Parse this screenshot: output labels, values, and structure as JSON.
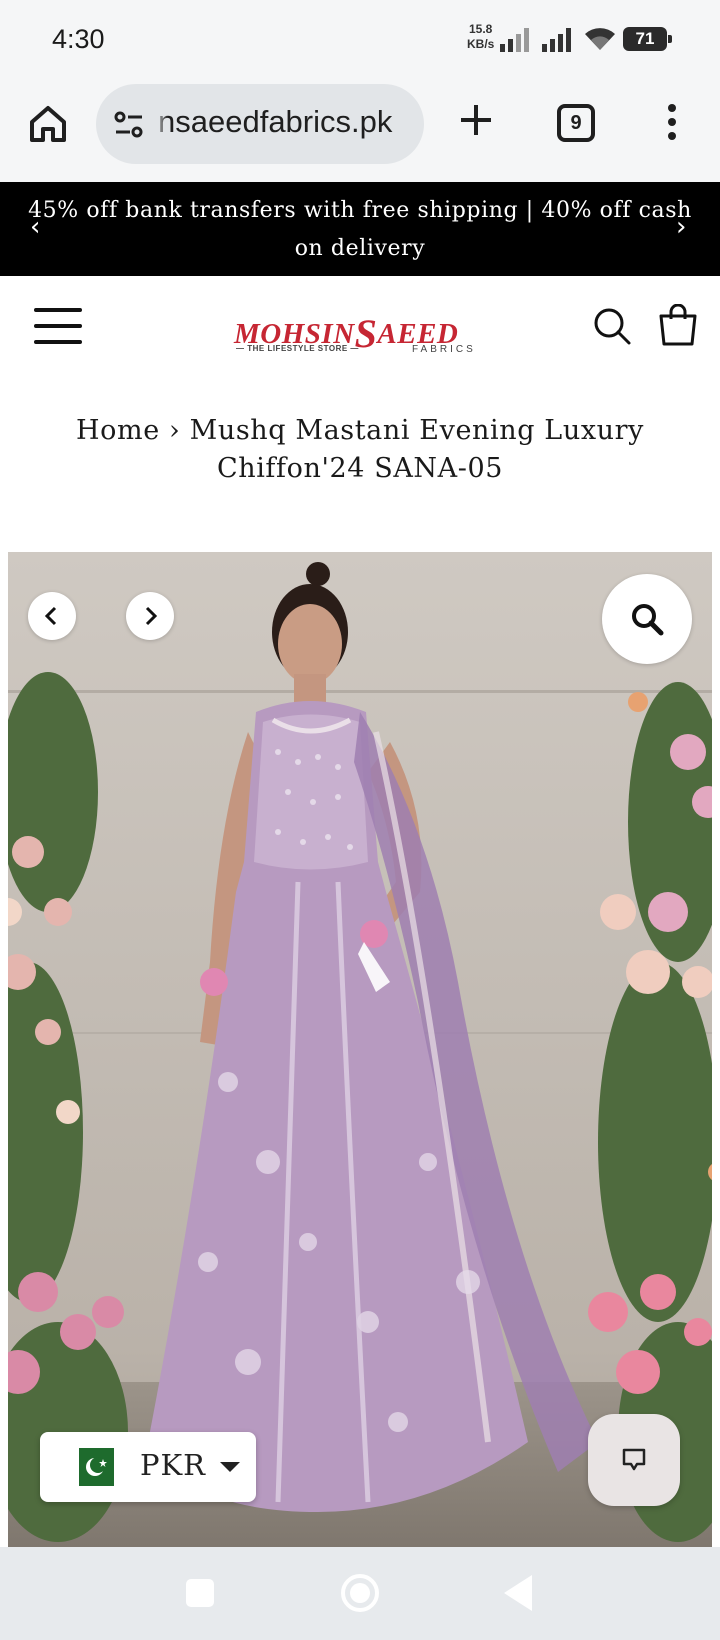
{
  "status_bar": {
    "time": "4:30",
    "net_speed_value": "15.8",
    "net_speed_unit": "KB/s",
    "battery": "71"
  },
  "browser": {
    "url": "nsaeedfabrics.pk",
    "tab_count": "9",
    "icons": [
      "home-icon",
      "tune-icon",
      "plus-icon",
      "tabs-icon",
      "more-vert-icon"
    ]
  },
  "promo": {
    "text": "45% off bank transfers with free shipping | 40% off cash on delivery"
  },
  "header": {
    "logo_main": "MOHSIN",
    "logo_second": "AEED",
    "logo_tagline": "— THE LIFESTYLE STORE —",
    "logo_fabrics": "FABRICS",
    "brand_color": "#c62633"
  },
  "breadcrumb": {
    "home": "Home",
    "separator": "›",
    "current": "Mushq Mastani Evening Luxury Chiffon'24 SANA-05"
  },
  "currency": {
    "code": "PKR"
  },
  "colors": {
    "promo_bg": "#000000",
    "browser_bg": "#f5f6f7",
    "url_pill": "#e2e5e8",
    "dress": "#b79ac0"
  }
}
